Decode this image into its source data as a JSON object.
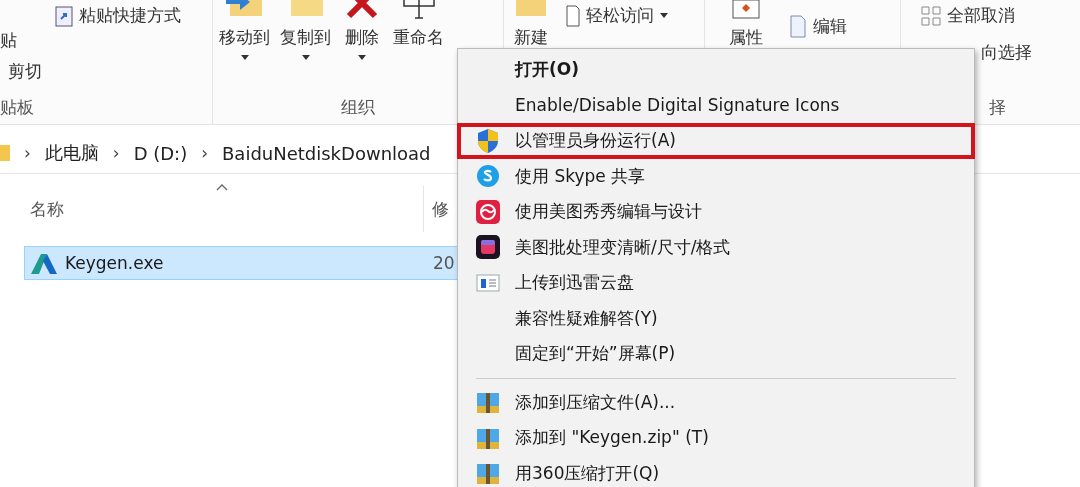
{
  "ribbon": {
    "groups": [
      {
        "kind": "clipboard",
        "label": "贴板",
        "paste": "贴",
        "shortcut": "粘贴快捷方式",
        "cut": "剪切"
      },
      {
        "kind": "organize",
        "label": "组织",
        "buttons": [
          {
            "label": "移动到"
          },
          {
            "label": "复制到"
          },
          {
            "label": "删除"
          },
          {
            "label": "重命名"
          }
        ]
      },
      {
        "kind": "new",
        "buttons": [
          {
            "label": "新建"
          }
        ],
        "access": "轻松访问"
      },
      {
        "kind": "open",
        "properties": "属性",
        "edit": "编辑"
      },
      {
        "kind": "select",
        "label": "择",
        "select_none": "全部取消",
        "invert": "向选择"
      }
    ]
  },
  "address": {
    "separator": "›",
    "parts": [
      "此电脑",
      "D (D:)",
      "BaiduNetdiskDownload"
    ]
  },
  "columns": [
    "名称",
    "修"
  ],
  "files": [
    {
      "name": "Keygen.exe",
      "date": "20",
      "selected": true
    }
  ],
  "context_menu": {
    "items": [
      {
        "kind": "plain",
        "label": "打开(O)",
        "default": true,
        "highlighted": false
      },
      {
        "kind": "plain",
        "label": "Enable/Disable Digital Signature Icons",
        "default": false,
        "highlighted": false
      },
      {
        "kind": "shield",
        "label": "以管理员身份运行(A)",
        "default": false,
        "highlighted": true
      },
      {
        "kind": "skype",
        "label": "使用 Skype 共享",
        "default": false,
        "highlighted": false
      },
      {
        "kind": "meitu",
        "label": "使用美图秀秀编辑与设计",
        "default": false,
        "highlighted": false
      },
      {
        "kind": "batch",
        "label": "美图批处理变清晰/尺寸/格式",
        "default": false,
        "highlighted": false
      },
      {
        "kind": "cloud",
        "label": "上传到迅雷云盘",
        "default": false,
        "highlighted": false
      },
      {
        "kind": "plain",
        "label": "兼容性疑难解答(Y)",
        "default": false,
        "highlighted": false
      },
      {
        "kind": "plain",
        "label": "固定到“开始”屏幕(P)",
        "default": false,
        "highlighted": false
      },
      {
        "kind": "separator"
      },
      {
        "kind": "archive",
        "label": "添加到压缩文件(A)...",
        "default": false,
        "highlighted": false
      },
      {
        "kind": "archive",
        "label": "添加到 \"Keygen.zip\" (T)",
        "default": false,
        "highlighted": false
      },
      {
        "kind": "archive",
        "label": "用360压缩打开(Q)",
        "default": false,
        "highlighted": false
      }
    ]
  }
}
